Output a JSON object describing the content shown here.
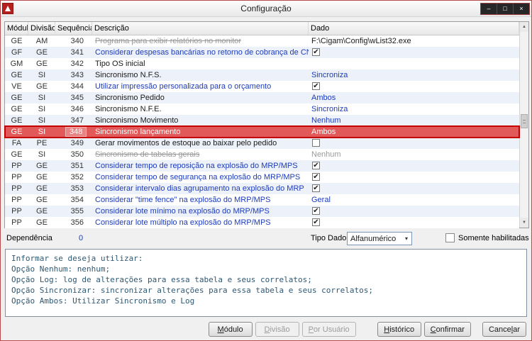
{
  "window": {
    "title": "Configuração",
    "controls": {
      "minimize": "–",
      "maximize": "□",
      "close": "×"
    }
  },
  "table": {
    "headers": {
      "modulo": "Módulo",
      "divisao": "Divisão",
      "sequencia": "Sequência",
      "descricao": "Descrição",
      "dado": "Dado"
    },
    "rows": [
      {
        "modulo": "GE",
        "divisao": "AM",
        "seq": "340",
        "desc": "Programa para exibir relatórios no monitor",
        "desc_style": "strike",
        "dado_kind": "text",
        "dado": "F:\\Cigam\\Config\\wList32.exe",
        "dado_style": "black"
      },
      {
        "modulo": "GF",
        "divisao": "GE",
        "seq": "341",
        "desc": "Considerar despesas bancárias no retorno de cobrança de CNAB",
        "desc_style": "blue",
        "dado_kind": "check"
      },
      {
        "modulo": "GM",
        "divisao": "GE",
        "seq": "342",
        "desc": "Tipo OS inicial",
        "desc_style": "black",
        "dado_kind": "none"
      },
      {
        "modulo": "GE",
        "divisao": "SI",
        "seq": "343",
        "desc": "Sincronismo N.F.S.",
        "desc_style": "black",
        "dado_kind": "text",
        "dado": "Sincroniza",
        "dado_style": "blue"
      },
      {
        "modulo": "VE",
        "divisao": "GE",
        "seq": "344",
        "desc": "Utilizar impressão personalizada para o orçamento",
        "desc_style": "blue",
        "dado_kind": "check"
      },
      {
        "modulo": "GE",
        "divisao": "SI",
        "seq": "345",
        "desc": "Sincronismo Pedido",
        "desc_style": "black",
        "dado_kind": "text",
        "dado": "Ambos",
        "dado_style": "blue"
      },
      {
        "modulo": "GE",
        "divisao": "SI",
        "seq": "346",
        "desc": "Sincronismo N.F.E.",
        "desc_style": "black",
        "dado_kind": "text",
        "dado": "Sincroniza",
        "dado_style": "blue"
      },
      {
        "modulo": "GE",
        "divisao": "SI",
        "seq": "347",
        "desc": "Sincronismo Movimento",
        "desc_style": "black",
        "dado_kind": "text",
        "dado": "Nenhum",
        "dado_style": "blue"
      },
      {
        "modulo": "GE",
        "divisao": "SI",
        "seq": "348",
        "desc": "Sincronismo lançamento",
        "desc_style": "white",
        "dado_kind": "text",
        "dado": "Ambos",
        "dado_style": "white",
        "selected": true
      },
      {
        "modulo": "FA",
        "divisao": "PE",
        "seq": "349",
        "desc": "Gerar movimentos de estoque ao baixar pelo pedido",
        "desc_style": "black",
        "dado_kind": "uncheck"
      },
      {
        "modulo": "GE",
        "divisao": "SI",
        "seq": "350",
        "desc": "Sincronismo de tabelas gerais",
        "desc_style": "strike",
        "dado_kind": "text",
        "dado": "Nenhum",
        "dado_style": "gray"
      },
      {
        "modulo": "PP",
        "divisao": "GE",
        "seq": "351",
        "desc": "Considerar tempo de reposição na explosão do MRP/MPS",
        "desc_style": "blue",
        "dado_kind": "check"
      },
      {
        "modulo": "PP",
        "divisao": "GE",
        "seq": "352",
        "desc": "Considerar tempo de segurança na explosão do MRP/MPS",
        "desc_style": "blue",
        "dado_kind": "check"
      },
      {
        "modulo": "PP",
        "divisao": "GE",
        "seq": "353",
        "desc": "Considerar intervalo dias agrupamento na explosão do MRP",
        "desc_style": "blue",
        "dado_kind": "check"
      },
      {
        "modulo": "PP",
        "divisao": "GE",
        "seq": "354",
        "desc": "Considerar \"time fence\" na explosão do MRP/MPS",
        "desc_style": "blue",
        "dado_kind": "text",
        "dado": "Geral",
        "dado_style": "blue"
      },
      {
        "modulo": "PP",
        "divisao": "GE",
        "seq": "355",
        "desc": "Considerar lote mínimo na explosão do MRP/MPS",
        "desc_style": "blue",
        "dado_kind": "check"
      },
      {
        "modulo": "PP",
        "divisao": "GE",
        "seq": "356",
        "desc": "Considerar lote múltiplo na explosão do MRP/MPS",
        "desc_style": "blue",
        "dado_kind": "check"
      }
    ]
  },
  "footer_info": {
    "dependencia_label": "Dependência",
    "dependencia_value": "0",
    "tipo_dado_label": "Tipo Dado",
    "tipo_dado_value": "Alfanumérico",
    "somente_habilitadas_label": "Somente habilitadas"
  },
  "help_text": {
    "lines": [
      "Informar se deseja utilizar:",
      "Opção Nenhum: nenhum;",
      "Opção Log: log de alterações para essa tabela e seus correlatos;",
      "Opção Sincronizar: sincronizar alterações para essa tabela e seus correlatos;",
      "Opção Ambos: Utilizar Sincronismo e Log"
    ]
  },
  "buttons": [
    {
      "name": "modulo-button",
      "label": "Módulo",
      "key": 0,
      "enabled": true
    },
    {
      "name": "divisao-button",
      "label": "Divisão",
      "key": 0,
      "enabled": false
    },
    {
      "name": "por-usuario-button",
      "label": "Por Usuário",
      "key": 0,
      "enabled": false
    },
    {
      "name": "historico-button",
      "label": "Histórico",
      "key": 0,
      "enabled": true
    },
    {
      "name": "confirmar-button",
      "label": "Confirmar",
      "key": 0,
      "enabled": true
    },
    {
      "name": "cancelar-button",
      "label": "Cancelar",
      "key": 5,
      "enabled": true
    }
  ],
  "colors": {
    "selected_row_bg": "#e2595a",
    "selected_row_border": "#c40000",
    "link_blue": "#1c3bbd",
    "alt_row": "#edf1fa",
    "window_border": "#b84b4b"
  }
}
